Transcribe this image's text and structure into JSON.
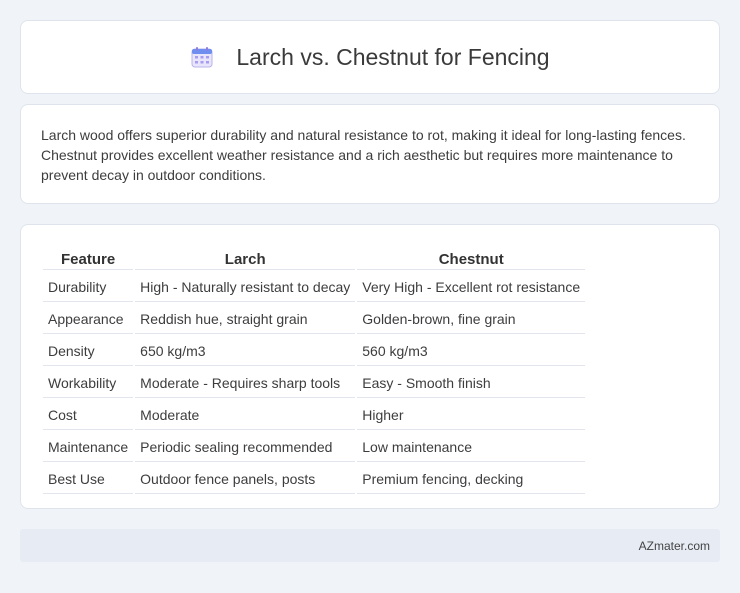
{
  "header": {
    "title": "Larch vs. Chestnut for Fencing",
    "icon": "calendar-icon"
  },
  "summary": {
    "text": "Larch wood offers superior durability and natural resistance to rot, making it ideal for long-lasting fences. Chestnut provides excellent weather resistance and a rich aesthetic but requires more maintenance to prevent decay in outdoor conditions."
  },
  "table": {
    "headers": [
      "Feature",
      "Larch",
      "Chestnut"
    ],
    "rows": [
      [
        "Durability",
        "High - Naturally resistant to decay",
        "Very High - Excellent rot resistance"
      ],
      [
        "Appearance",
        "Reddish hue, straight grain",
        "Golden-brown, fine grain"
      ],
      [
        "Density",
        "650 kg/m3",
        "560 kg/m3"
      ],
      [
        "Workability",
        "Moderate - Requires sharp tools",
        "Easy - Smooth finish"
      ],
      [
        "Cost",
        "Moderate",
        "Higher"
      ],
      [
        "Maintenance",
        "Periodic sealing recommended",
        "Low maintenance"
      ],
      [
        "Best Use",
        "Outdoor fence panels, posts",
        "Premium fencing, decking"
      ]
    ]
  },
  "footer": {
    "site": "AZmater.com"
  }
}
